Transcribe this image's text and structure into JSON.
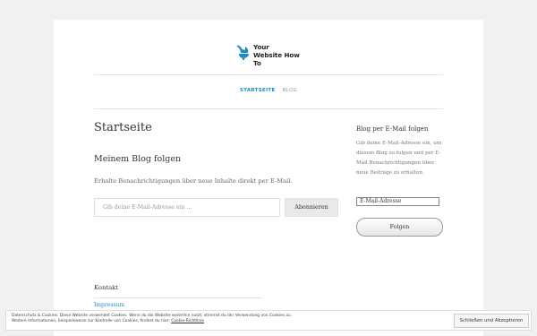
{
  "site": {
    "logo_line1": "Your",
    "logo_line2": "Website How To",
    "logo_icon": "swan-chair-icon",
    "accent": "#1e8cbe"
  },
  "nav": {
    "items": [
      {
        "label": "STARTSEITE",
        "active": true
      },
      {
        "label": "BLOG",
        "active": false
      }
    ]
  },
  "main": {
    "title": "Startseite",
    "section_title": "Meinem Blog folgen",
    "description": "Erhalte Benachrichtigungen über neue Inhalte direkt per E-Mail.",
    "email_placeholder": "Gib deine E-Mail-Adresse ein ...",
    "subscribe_label": "Abonnieren"
  },
  "sidebar": {
    "title": "Blog per E-Mail folgen",
    "description": "Gib deine E-Mail-Adresse ein, um diesem Blog zu folgen und per E-Mail Benachrichtigungen über neue Beiträge zu erhalten.",
    "email_value": "E-Mail-Adresse",
    "follow_label": "Folgen"
  },
  "footer": {
    "title": "Kontakt",
    "link": "Impressum"
  },
  "cookie": {
    "text_line1": "Datenschutz & Cookies: Diese Website verwendet Cookies. Wenn du die Website weiterhin nutzt, stimmst du der Verwendung von Cookies zu.",
    "text_line2": "Weitere Informationen, beispielsweise zur Kontrolle von Cookies, findest du hier:",
    "link": "Cookie-Richtlinie",
    "button": "Schließen und Akzeptieren"
  }
}
